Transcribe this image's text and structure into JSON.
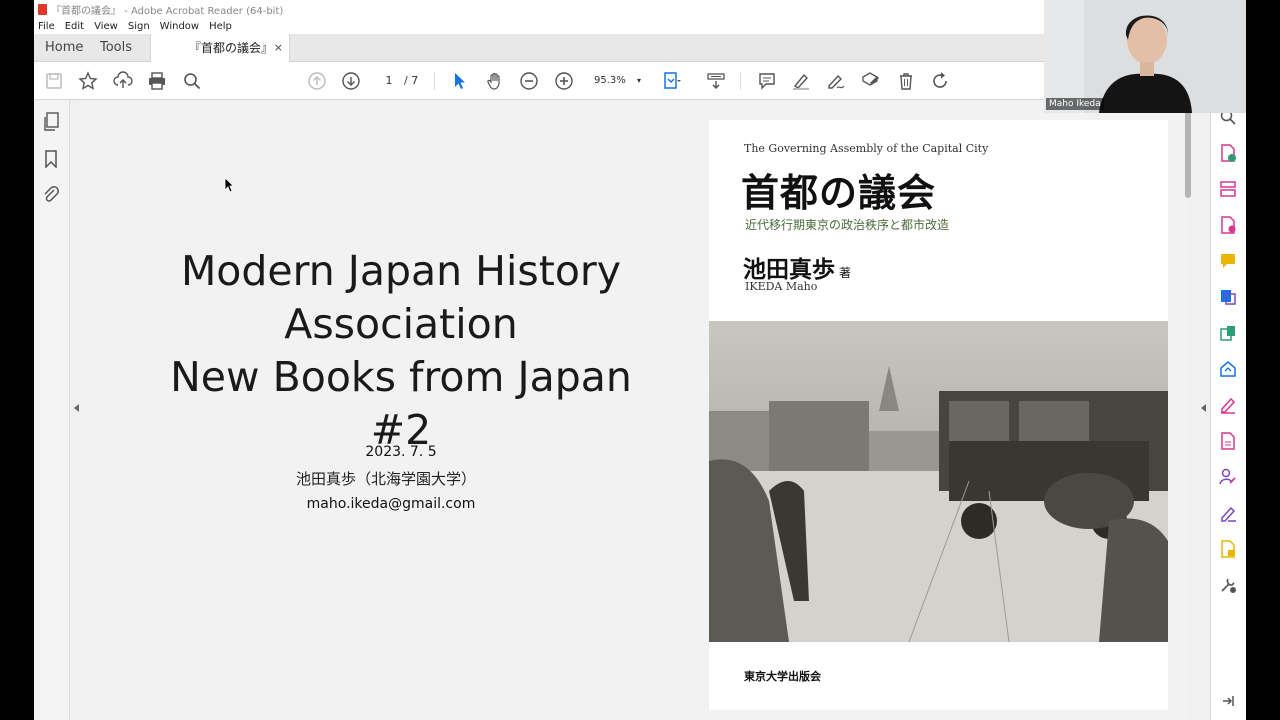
{
  "app": {
    "window_title": "『首都の議会』 - Adobe Acrobat Reader (64-bit)",
    "menu": [
      "File",
      "Edit",
      "View",
      "Sign",
      "Window",
      "Help"
    ],
    "nav_tabs": [
      "Home",
      "Tools"
    ],
    "doc_tab": "『首都の議会』",
    "doc_tab_close": "×"
  },
  "toolbar": {
    "page_current": "1",
    "page_total": "/ 7",
    "zoom": "95.3%",
    "icons": [
      "save-icon",
      "star-icon",
      "upload-icon",
      "print-icon",
      "search-icon",
      "page-up-icon",
      "page-down-icon",
      "select-cursor-icon",
      "hand-icon",
      "zoom-out-icon",
      "zoom-in-icon",
      "fit-page-icon",
      "scroll-mode-icon",
      "comment-icon",
      "highlight-icon",
      "sign-icon",
      "edit-icon",
      "delete-icon",
      "rotate-icon"
    ]
  },
  "left_panel": {
    "icons": [
      "pages-icon",
      "bookmark-icon",
      "attachment-icon"
    ]
  },
  "right_panel": {
    "icons": [
      "zoom-tool-icon",
      "create-pdf-icon",
      "organize-pages-icon",
      "export-pdf-icon",
      "comment-tool-icon",
      "convert-icon",
      "edit-pdf-icon",
      "share-icon",
      "fill-sign-icon",
      "pdf-doc-icon",
      "request-sign-icon",
      "fill-form-icon",
      "protect-icon",
      "more-tools-icon",
      "expand-icon"
    ]
  },
  "slide": {
    "title_lines": [
      "Modern Japan History",
      "Association",
      "New Books from Japan #2"
    ],
    "date": "2023. 7. 5",
    "author": "池田真歩（北海学園大学）",
    "email": "maho.ikeda@gmail.com"
  },
  "cover": {
    "english_title": "The Governing Assembly of the Capital City",
    "title": "首都の議会",
    "subtitle": "近代移行期東京の政治秩序と都市改造",
    "author": "池田真歩",
    "author_suffix": "著",
    "author_en": "IKEDA Maho",
    "publisher": "東京大学出版会"
  },
  "video": {
    "participant_name": "Maho Ikeda"
  },
  "colors": {
    "pdf_red": "#e0362c",
    "acrobat_blue": "#1473e6",
    "tool_pink": "#d83790",
    "tool_green": "#2d9d78",
    "tool_yellow": "#e8b600",
    "tool_purple": "#7a46c2"
  }
}
